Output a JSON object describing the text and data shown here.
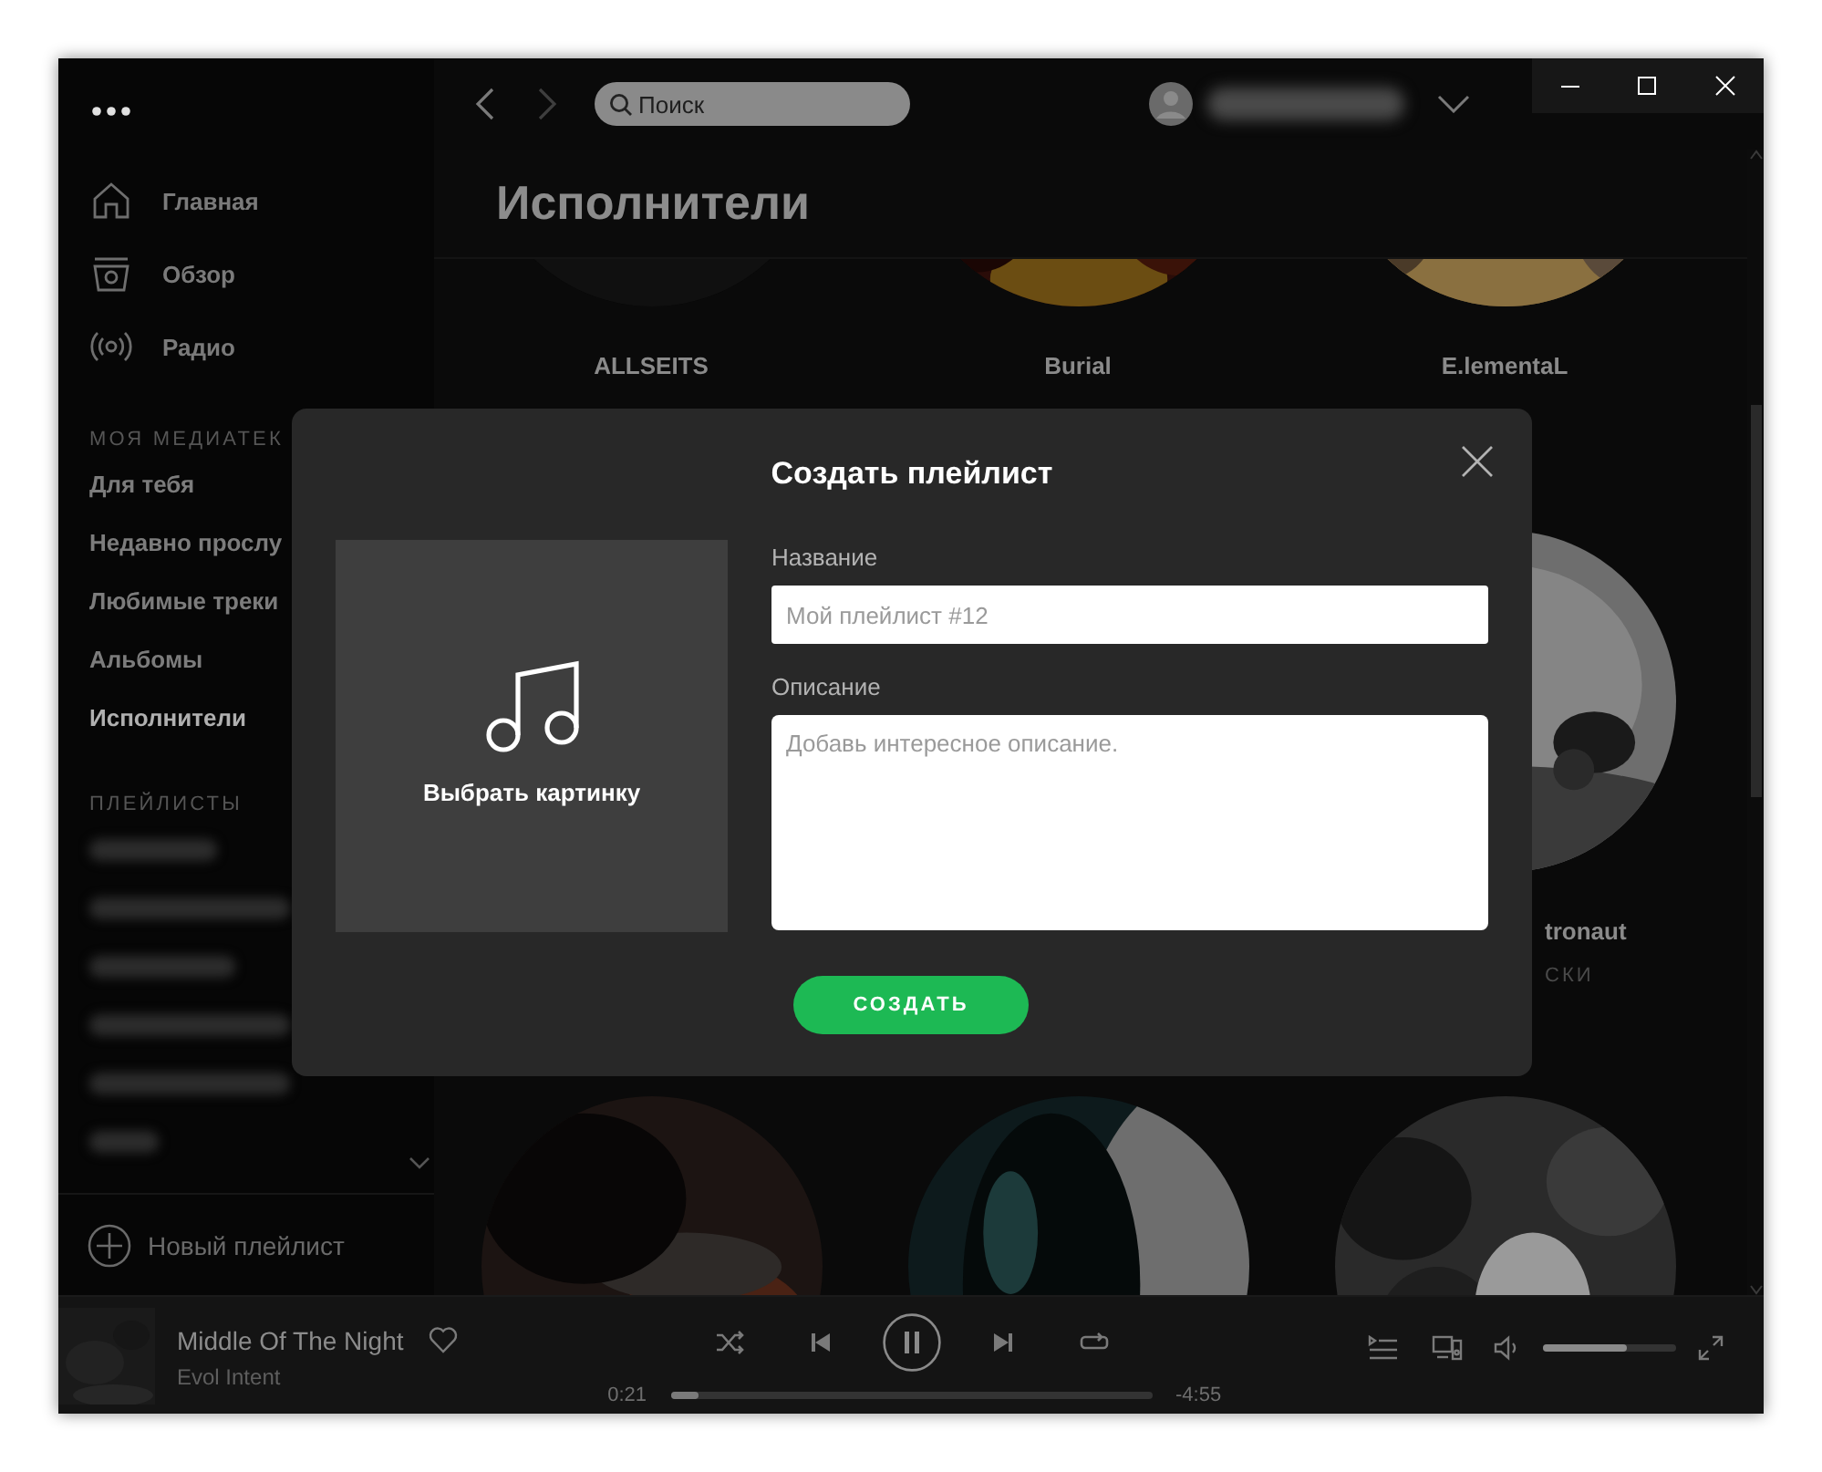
{
  "sidebar": {
    "nav": [
      {
        "label": "Главная",
        "kind": "home"
      },
      {
        "label": "Обзор",
        "kind": "browse"
      },
      {
        "label": "Радио",
        "kind": "radio"
      }
    ],
    "library_heading": "МОЯ МЕДИАТЕК",
    "library": [
      {
        "label": "Для тебя",
        "selected": false
      },
      {
        "label": "Недавно прослу",
        "selected": false
      },
      {
        "label": "Любимые треки",
        "selected": false
      },
      {
        "label": "Альбомы",
        "selected": false
      },
      {
        "label": "Исполнители",
        "selected": true
      }
    ],
    "playlists_heading": "ПЛЕЙЛИСТЫ",
    "new_playlist": "Новый плейлист"
  },
  "top_bar": {
    "search": {
      "placeholder": "Поиск"
    }
  },
  "page_title": "Исполнители",
  "artists": [
    {
      "name": "ALLSEITS"
    },
    {
      "name": "Burial"
    },
    {
      "name": "E.lementaL"
    },
    {
      "name": "tronaut",
      "subtitle": "СКИ"
    }
  ],
  "dialog": {
    "title": "Создать плейлист",
    "image_label": "Выбрать картинку",
    "name_field": {
      "label": "Название",
      "placeholder": "Мой плейлист #12"
    },
    "description_field": {
      "label": "Описание",
      "placeholder": "Добавь интересное описание."
    },
    "create_button": "СОЗДАТЬ"
  },
  "player": {
    "track": "Middle Of The Night",
    "artist": "Evol Intent",
    "liked": false,
    "playing": true,
    "elapsed": "0:21",
    "remaining": "-4:55",
    "progress": {
      "level": 0.06
    },
    "volume": {
      "level": 0.63
    }
  }
}
